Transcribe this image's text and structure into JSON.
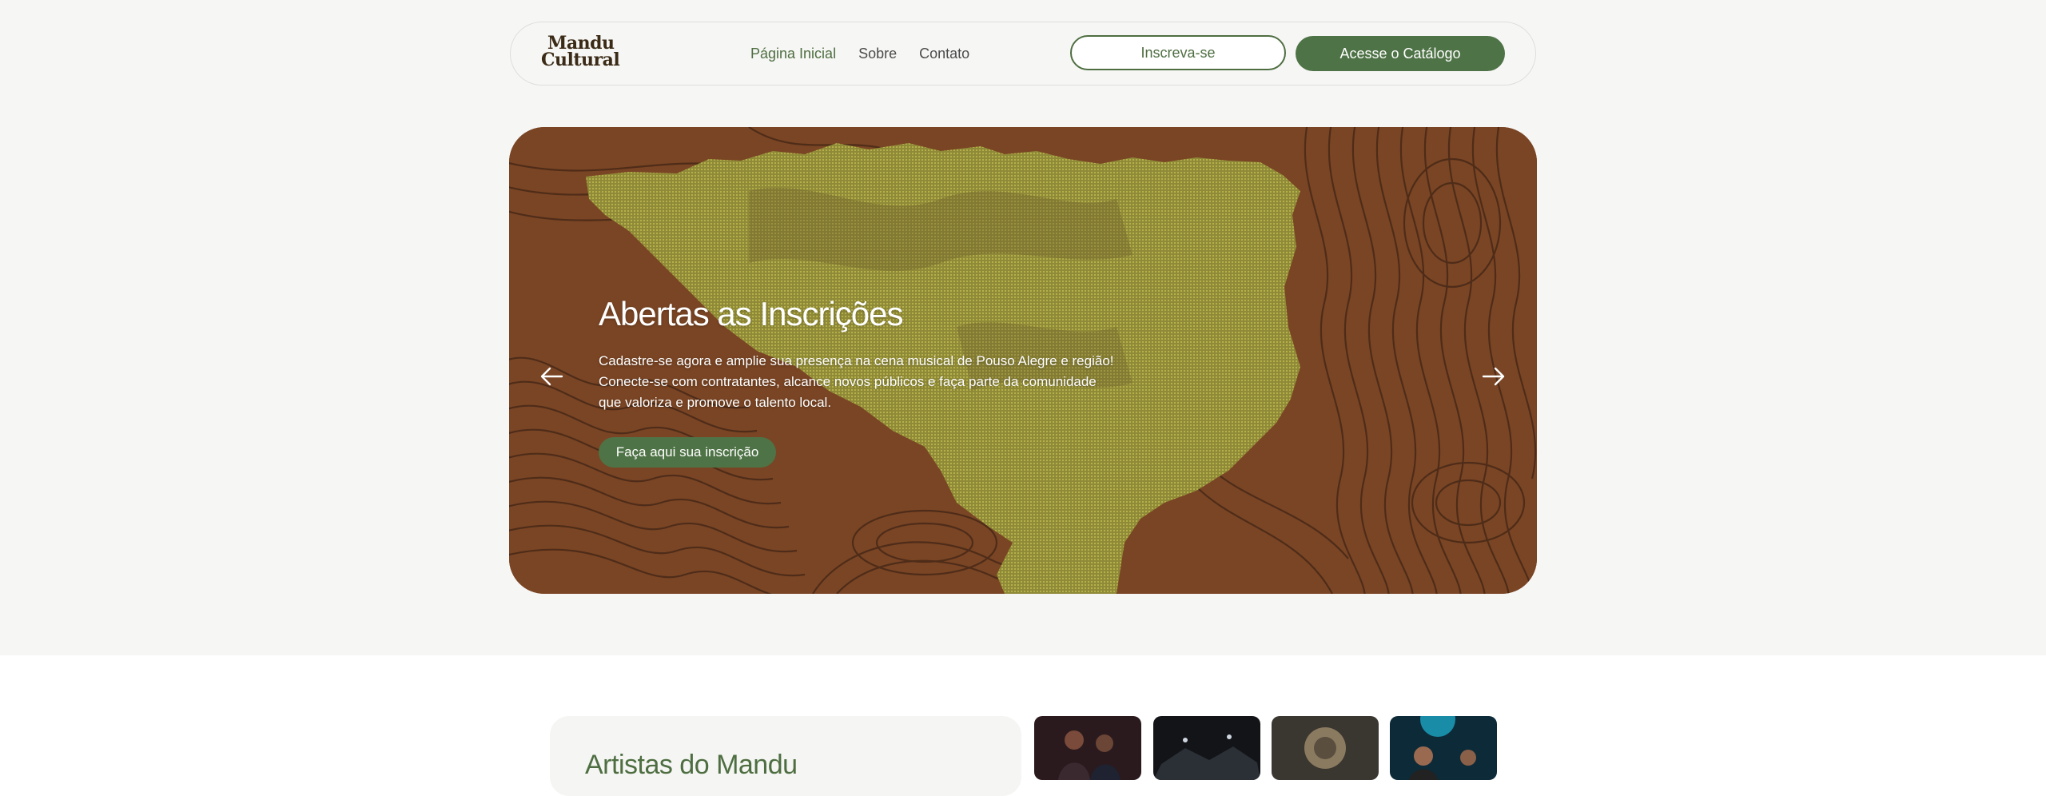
{
  "brand": {
    "logo_line1": "Mandu",
    "logo_line2": "Cultural",
    "color_primary": "#4e7346",
    "color_brown": "#7a4524",
    "color_map_green": "#9aa13e"
  },
  "nav": {
    "links": [
      {
        "label": "Página Inicial",
        "active": true
      },
      {
        "label": "Sobre",
        "active": false
      },
      {
        "label": "Contato",
        "active": false
      }
    ],
    "signup_label": "Inscreva-se",
    "catalog_label": "Acesse o Catálogo"
  },
  "hero": {
    "title": "Abertas as Inscrições",
    "body_lines": [
      "Cadastre-se agora e amplie sua presença na cena musical de Pouso Alegre e região!",
      "Conecte-se com contratantes, alcance novos públicos e faça parte da comunidade",
      "que valoriza e promove o talento local."
    ],
    "cta_label": "Faça aqui sua inscrição",
    "prev_icon": "arrow-left-icon",
    "next_icon": "arrow-right-icon"
  },
  "artists": {
    "title": "Artistas do Mandu",
    "thumbnails": [
      "artist-photo-1",
      "artist-photo-2",
      "artist-photo-3",
      "artist-photo-4"
    ]
  }
}
